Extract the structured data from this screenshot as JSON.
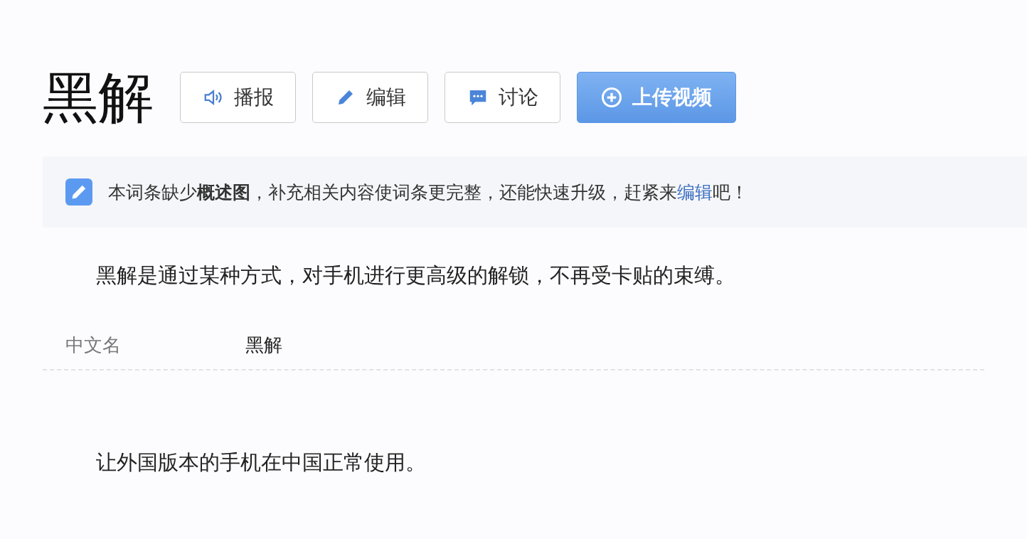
{
  "title": "黑解",
  "buttons": [
    {
      "label": "播报",
      "kind": "speaker",
      "primary": false
    },
    {
      "label": "编辑",
      "kind": "pencil",
      "primary": false
    },
    {
      "label": "讨论",
      "kind": "chat",
      "primary": false
    },
    {
      "label": "上传视频",
      "kind": "plus",
      "primary": true
    }
  ],
  "notice": {
    "text_before": "本词条缺少**概述图**，补充相关内容使词条更完整，还能快速升级，赶紧来",
    "link": "编辑",
    "text_after": "吧！"
  },
  "summary": "黑解是通过某种方式，对手机进行更高级的解锁，不再受卡贴的束缚。",
  "basic_info": [
    {
      "label": "中文名",
      "value": "黑解"
    }
  ],
  "paragraphs": [
    "让外国版本的手机在中国正常使用。"
  ]
}
